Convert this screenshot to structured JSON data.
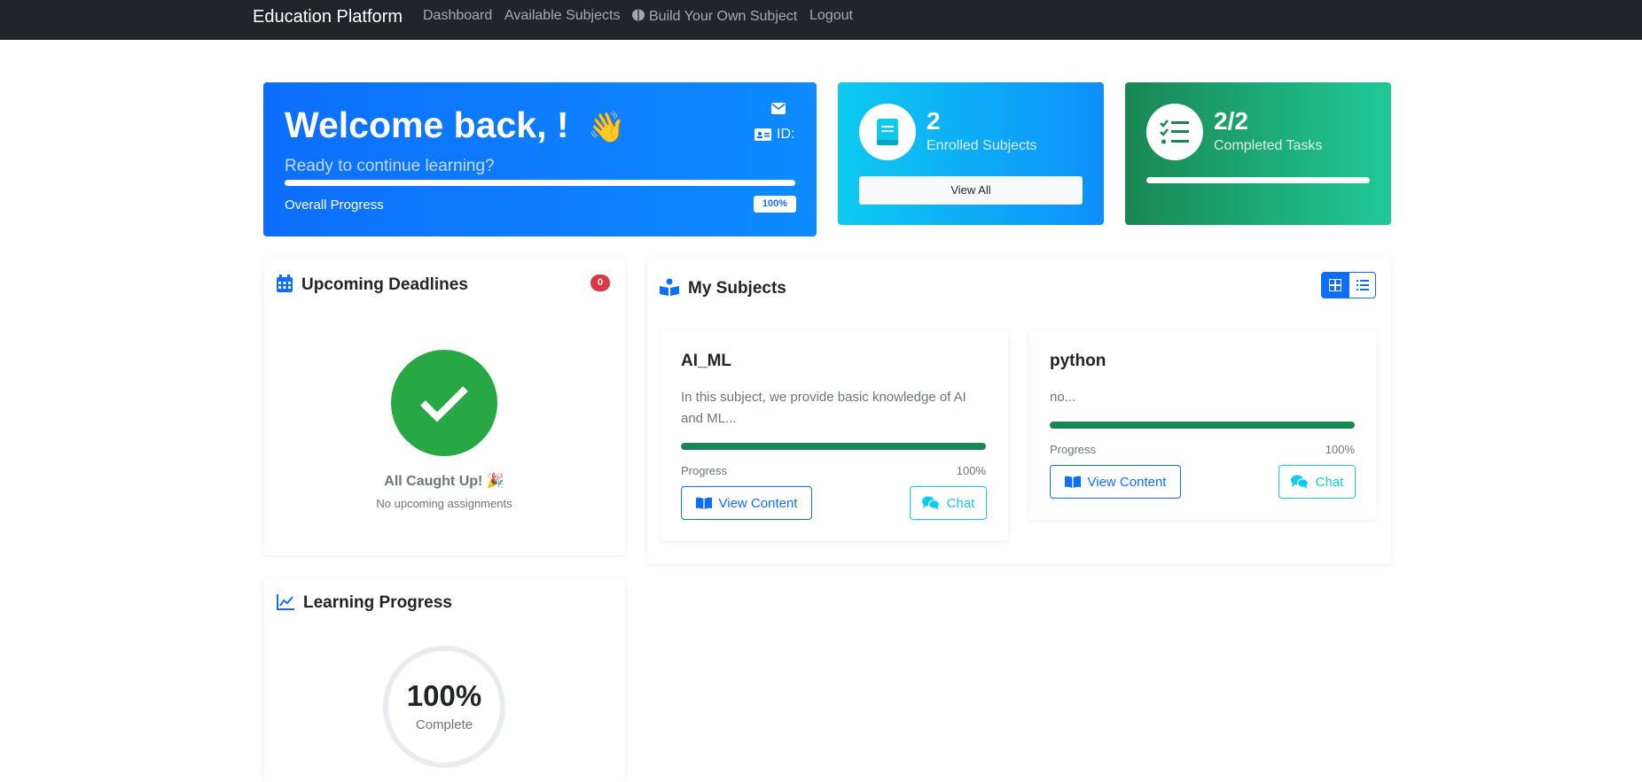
{
  "nav": {
    "brand": "Education Platform",
    "links": [
      "Dashboard",
      "Available Subjects",
      "Build Your Own Subject",
      "Logout"
    ],
    "build_icon": "brain-icon"
  },
  "welcome": {
    "title": "Welcome back, !",
    "emoji": "👋",
    "subtitle": "Ready to continue learning?",
    "id_label": "ID:",
    "progress_label": "Overall Progress",
    "progress_value": "100%",
    "progress_fraction": 1.0
  },
  "stats": {
    "enrolled": {
      "value": "2",
      "label": "Enrolled Subjects",
      "button": "View All",
      "icon": "book-icon"
    },
    "tasks": {
      "value": "2/2",
      "label": "Completed Tasks",
      "icon": "tasks-icon",
      "progress_fraction": 1.0
    }
  },
  "deadlines": {
    "title": "Upcoming Deadlines",
    "count": "0",
    "empty_title": "All Caught Up! 🎉",
    "empty_text": "No upcoming assignments"
  },
  "subjects": {
    "title": "My Subjects",
    "items": [
      {
        "name": "AI_ML",
        "description": "In this subject, we provide basic knowledge of AI and ML...",
        "progress_label": "Progress",
        "progress_value": "100%",
        "progress_fraction": 1.0,
        "view_label": "View Content",
        "chat_label": "Chat"
      },
      {
        "name": "python",
        "description": "no...",
        "progress_label": "Progress",
        "progress_value": "100%",
        "progress_fraction": 1.0,
        "view_label": "View Content",
        "chat_label": "Chat"
      }
    ]
  },
  "learning": {
    "title": "Learning Progress",
    "percent": "100%",
    "label": "Complete"
  },
  "colors": {
    "primary": "#0d6efd",
    "info": "#0dcaf0",
    "success": "#198754",
    "danger": "#dc3545",
    "navbar": "#212529"
  }
}
